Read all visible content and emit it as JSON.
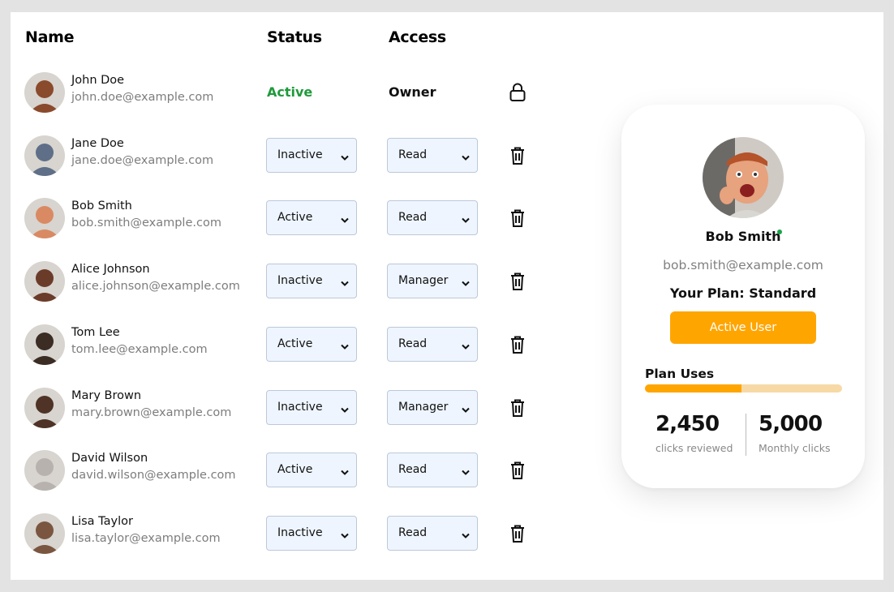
{
  "table": {
    "headers": {
      "name": "Name",
      "status": "Status",
      "access": "Access"
    },
    "rows": [
      {
        "name": "John Doe",
        "email": "john.doe@example.com",
        "status": "Active",
        "access": "Owner",
        "editable": false,
        "action_icon": "lock-icon",
        "avatar_color": "#8a4a2c"
      },
      {
        "name": "Jane Doe",
        "email": "jane.doe@example.com",
        "status": "Inactive",
        "access": "Read",
        "editable": true,
        "action_icon": "trash-icon",
        "avatar_color": "#5f6f88"
      },
      {
        "name": "Bob Smith",
        "email": "bob.smith@example.com",
        "status": "Active",
        "access": "Read",
        "editable": true,
        "action_icon": "trash-icon",
        "avatar_color": "#d98a63"
      },
      {
        "name": "Alice Johnson",
        "email": "alice.johnson@example.com",
        "status": "Inactive",
        "access": "Manager",
        "editable": true,
        "action_icon": "trash-icon",
        "avatar_color": "#6b3b2a"
      },
      {
        "name": "Tom Lee",
        "email": "tom.lee@example.com",
        "status": "Active",
        "access": "Read",
        "editable": true,
        "action_icon": "trash-icon",
        "avatar_color": "#3b2c24"
      },
      {
        "name": "Mary Brown",
        "email": "mary.brown@example.com",
        "status": "Inactive",
        "access": "Manager",
        "editable": true,
        "action_icon": "trash-icon",
        "avatar_color": "#4e3326"
      },
      {
        "name": "David Wilson",
        "email": "david.wilson@example.com",
        "status": "Active",
        "access": "Read",
        "editable": true,
        "action_icon": "trash-icon",
        "avatar_color": "#b8b2ae"
      },
      {
        "name": "Lisa Taylor",
        "email": "lisa.taylor@example.com",
        "status": "Inactive",
        "access": "Read",
        "editable": true,
        "action_icon": "trash-icon",
        "avatar_color": "#7a5640"
      }
    ]
  },
  "profile_card": {
    "name": "Bob Smith",
    "email": "bob.smith@example.com",
    "plan": "Your Plan: Standard",
    "button_label": "Active User",
    "uses_label": "Plan Uses",
    "uses_fraction": 0.49,
    "stat_reviewed_value": "2,450",
    "stat_reviewed_label": "clicks reviewed",
    "stat_monthly_value": "5,000",
    "stat_monthly_label": "Monthly clicks",
    "online": true
  },
  "colors": {
    "accent": "#ffa500",
    "accent_light": "#f7d9a6",
    "active_status": "#1f9a3a",
    "select_bg": "#eef5ff",
    "online": "#1aa34a"
  }
}
